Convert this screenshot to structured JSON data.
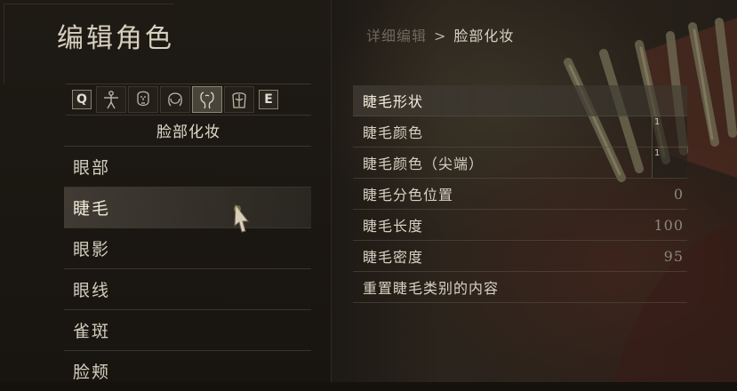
{
  "header": {
    "title": "编辑角色"
  },
  "breadcrumb": {
    "previous": "详细编辑",
    "separator": ">",
    "current": "脸部化妆"
  },
  "tabs": [
    {
      "label": "Q",
      "kind": "key"
    },
    {
      "icon": "body-icon"
    },
    {
      "icon": "face-icon"
    },
    {
      "icon": "hair-icon"
    },
    {
      "icon": "makeup-icon",
      "active": true
    },
    {
      "icon": "torso-icon"
    },
    {
      "label": "E",
      "kind": "key"
    }
  ],
  "section": {
    "title": "脸部化妆"
  },
  "menu": {
    "items": [
      {
        "label": "眼部"
      },
      {
        "label": "睫毛",
        "selected": true
      },
      {
        "label": "眼影"
      },
      {
        "label": "眼线"
      },
      {
        "label": "雀斑"
      },
      {
        "label": "脸颊"
      }
    ]
  },
  "options": [
    {
      "label": "睫毛形状",
      "value": ""
    },
    {
      "label": "睫毛颜色",
      "swatch": "1"
    },
    {
      "label": "睫毛颜色（尖端）",
      "swatch": "1"
    },
    {
      "label": "睫毛分色位置",
      "value": "0"
    },
    {
      "label": "睫毛长度",
      "value": "100"
    },
    {
      "label": "睫毛密度",
      "value": "95"
    },
    {
      "label": "重置睫毛类别的内容",
      "value": ""
    }
  ],
  "colors": {
    "accent": "#d8d2c4",
    "muted": "#6e685c",
    "highlight": "#4a463c"
  }
}
